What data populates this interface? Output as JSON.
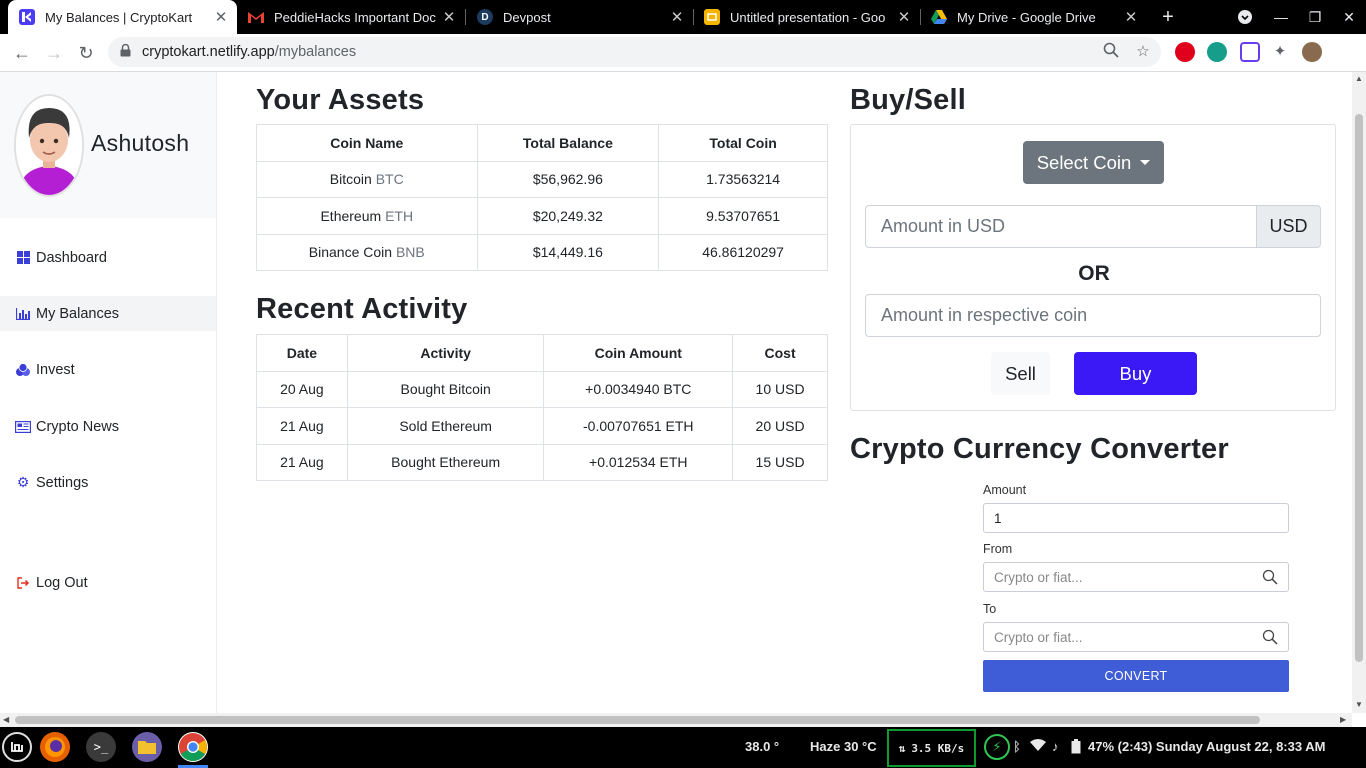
{
  "browser": {
    "tabs": [
      {
        "title": "My Balances | CryptoKart",
        "favicon": "cryptokart-icon",
        "fav_color": "#4a3cf7",
        "fav_glyph": "",
        "active": true
      },
      {
        "title": "PeddieHacks Important Doc",
        "favicon": "gmail-icon",
        "fav_color": "#000000",
        "fav_glyph": "M",
        "active": false
      },
      {
        "title": "Devpost",
        "favicon": "devpost-icon",
        "fav_color": "#1d3a5f",
        "fav_glyph": "D",
        "active": false
      },
      {
        "title": "Untitled presentation - Goo",
        "favicon": "slides-icon",
        "fav_color": "#f4b400",
        "fav_glyph": "",
        "active": false
      },
      {
        "title": "My Drive - Google Drive",
        "favicon": "drive-icon",
        "fav_color": "#0f9d58",
        "fav_glyph": "",
        "active": false
      }
    ],
    "url_host": "cryptokart.netlify.app",
    "url_path": "/mybalances"
  },
  "sidebar": {
    "username": "Ashutosh",
    "items": [
      {
        "label": "Dashboard",
        "icon": "dashboard-icon",
        "active": false
      },
      {
        "label": "My Balances",
        "icon": "bar-chart-icon",
        "active": true
      },
      {
        "label": "Invest",
        "icon": "coins-icon",
        "active": false
      },
      {
        "label": "Crypto News",
        "icon": "newspaper-icon",
        "active": false
      },
      {
        "label": "Settings",
        "icon": "gear-icon",
        "active": false
      },
      {
        "label": "Log Out",
        "icon": "logout-icon",
        "active": false
      }
    ]
  },
  "assets": {
    "title": "Your Assets",
    "headers": [
      "Coin Name",
      "Total Balance",
      "Total Coin"
    ],
    "rows": [
      {
        "name": "Bitcoin",
        "symbol": "BTC",
        "balance": "$56,962.96",
        "coins": "1.73563214"
      },
      {
        "name": "Ethereum",
        "symbol": "ETH",
        "balance": "$20,249.32",
        "coins": "9.53707651"
      },
      {
        "name": "Binance Coin",
        "symbol": "BNB",
        "balance": "$14,449.16",
        "coins": "46.86120297"
      }
    ]
  },
  "activity": {
    "title": "Recent Activity",
    "headers": [
      "Date",
      "Activity",
      "Coin Amount",
      "Cost"
    ],
    "rows": [
      [
        "20 Aug",
        "Bought Bitcoin",
        "+0.0034940 BTC",
        "10 USD"
      ],
      [
        "21 Aug",
        "Sold Ethereum",
        "-0.00707651 ETH",
        "20 USD"
      ],
      [
        "21 Aug",
        "Bought Ethereum",
        "+0.012534 ETH",
        "15 USD"
      ]
    ]
  },
  "buysell": {
    "title": "Buy/Sell",
    "select_label": "Select Coin",
    "usd_placeholder": "Amount in USD",
    "usd_addon": "USD",
    "or_label": "OR",
    "coin_placeholder": "Amount in respective coin",
    "sell_label": "Sell",
    "buy_label": "Buy"
  },
  "converter": {
    "title": "Crypto Currency Converter",
    "amount_label": "Amount",
    "amount_value": "1",
    "from_label": "From",
    "from_placeholder": "Crypto or fiat...",
    "to_label": "To",
    "to_placeholder": "Crypto or fiat...",
    "convert_label": "CONVERT"
  },
  "taskbar": {
    "temp": "38.0 °",
    "weather": "Haze 30 °C",
    "net_speed": "3.5 KB/s",
    "status": "47% (2:43) Sunday August 22,  8:33 AM"
  },
  "colors": {
    "accent": "#3a19f6",
    "convert": "#3f5dd6",
    "select_coin": "#6c757d",
    "nav_icon": "#3b3fd8"
  }
}
